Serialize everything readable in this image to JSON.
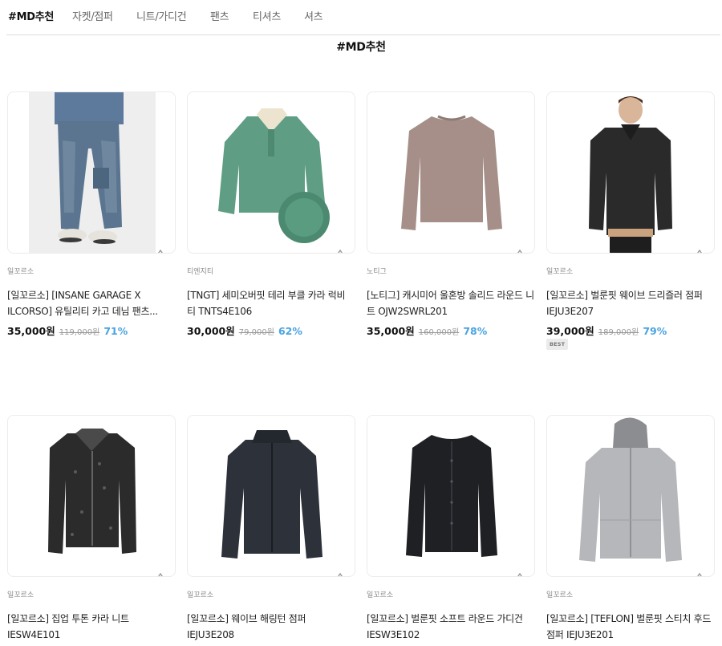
{
  "tabs": [
    {
      "label": "#MD추천",
      "active": true
    },
    {
      "label": "자켓/점퍼",
      "active": false
    },
    {
      "label": "니트/가디건",
      "active": false
    },
    {
      "label": "팬츠",
      "active": false
    },
    {
      "label": "티셔츠",
      "active": false
    },
    {
      "label": "셔츠",
      "active": false
    }
  ],
  "section": {
    "title": "#MD추천"
  },
  "products": [
    {
      "brand": "일꼬르소",
      "name": "[일꼬르소] [INSANE GARAGE X ILCORSO] 유틸리티 카고 데님 팬츠...",
      "price": "35,000원",
      "original_price": "119,000원",
      "discount": "71%",
      "image": "denim-cargo-pants"
    },
    {
      "brand": "티엔지티",
      "name": "[TNGT] 세미오버핏 테리 부클 카라 럭비 티 TNTS4E106",
      "price": "30,000원",
      "original_price": "79,000원",
      "discount": "62%",
      "image": "green-boucle-polo"
    },
    {
      "brand": "노티그",
      "name": "[노티그] 캐시미어 울혼방 솔리드 라운드 니트 OJW2SWRL201",
      "price": "35,000원",
      "original_price": "160,000원",
      "discount": "78%",
      "image": "beige-round-knit"
    },
    {
      "brand": "일꼬르소",
      "name": "[일꼬르소] 벌룬핏 웨이브 드리즐러 점퍼 IEJU3E207",
      "price": "39,000원",
      "original_price": "189,000원",
      "discount": "79%",
      "badge": "BEST",
      "image": "black-drizzler-jacket"
    },
    {
      "brand": "일꼬르소",
      "name": "[일꼬르소] 집업 투톤 카라 니트 IESW4E101",
      "image": "black-zipup-knit"
    },
    {
      "brand": "일꼬르소",
      "name": "[일꼬르소] 웨이브 해링턴 점퍼 IEJU3E208",
      "image": "navy-harrington-jacket"
    },
    {
      "brand": "일꼬르소",
      "name": "[일꼬르소] 벌룬핏 소프트 라운드 가디건 IESW3E102",
      "image": "black-round-cardigan"
    },
    {
      "brand": "일꼬르소",
      "name": "[일꼬르소] [TEFLON] 벌룬핏 스티치 후드 점퍼 IEJU3E201",
      "image": "gray-hood-jacket"
    }
  ],
  "icons": {
    "cart": "shopping-basket-icon"
  },
  "colors": {
    "discount": "#4aa3df",
    "active_tab": "#111111",
    "inactive_tab": "#666666"
  }
}
